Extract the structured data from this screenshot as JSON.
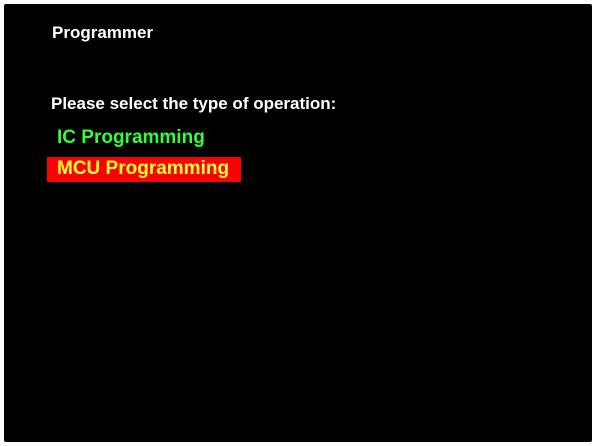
{
  "screen": {
    "title": "Programmer",
    "prompt": "Please select the type of operation:"
  },
  "menu": {
    "items": [
      {
        "label": "IC Programming",
        "selected": false
      },
      {
        "label": "MCU Programming",
        "selected": true
      }
    ],
    "item_color": "#33ff33",
    "selected_color": "#ffff33",
    "selected_background": "#ff0000"
  },
  "colors": {
    "background": "#000000",
    "text": "#ffffff"
  }
}
